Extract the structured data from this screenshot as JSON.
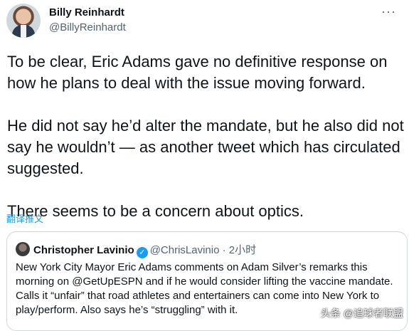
{
  "author": {
    "name": "Billy Reinhardt",
    "handle": "@BillyReinhardt"
  },
  "more_label": "···",
  "tweet": {
    "paragraphs": [
      "To be clear, Eric Adams gave no definitive response on how he plans to deal with the issue moving forward.",
      "He did not say he’d alter the mandate, but he also did not say he wouldn’t — as another tweet which has circulated suggested.",
      "There seems to be a concern about optics."
    ],
    "translate_label": "翻译推文"
  },
  "quote": {
    "name": "Christopher Lavinio",
    "verified_glyph": "✓",
    "handle": "@ChrisLavinio",
    "separator": "·",
    "time": "2小时",
    "text": "New York City Mayor Eric Adams comments on Adam Silver’s remarks this morning on @GetUpESPN and if he would consider lifting the vaccine mandate. Calls it “unfair” that road athletes and entertainers can come into New York to play/perform. Also says he’s “struggling” with it."
  },
  "watermark": "头条 @追球者联盟",
  "colors": {
    "text": "#0f1419",
    "secondary": "#536471",
    "link": "#1d9bf0",
    "border": "#cfd9de"
  }
}
